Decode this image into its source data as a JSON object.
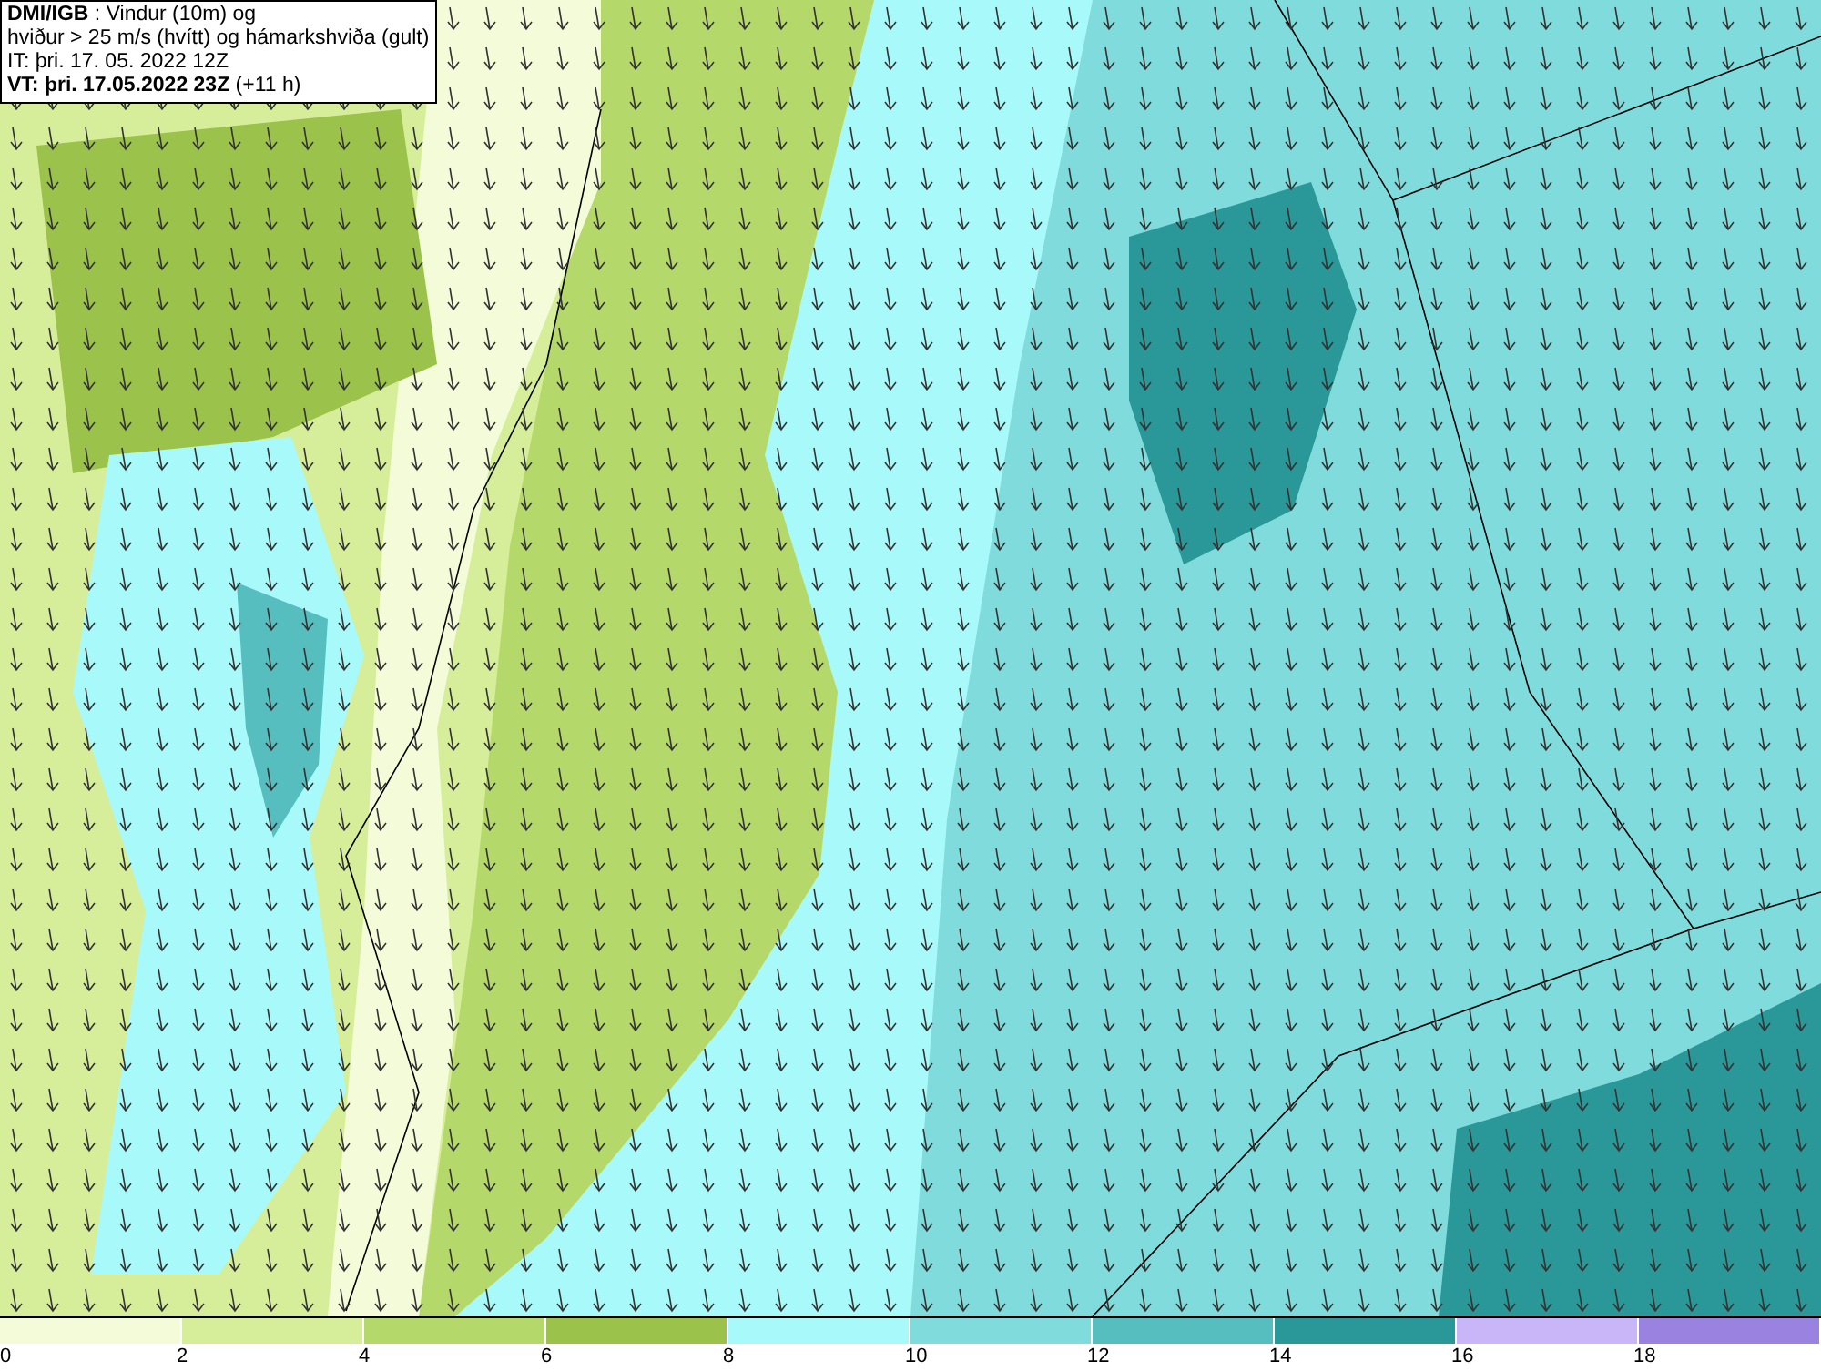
{
  "title_box": {
    "lines": [
      "**DMI/IGB** : Vindur (10m) og",
      "hviður > 25 m/s (hvítt) og hámarkshviða (gult)",
      "IT: þri. 17. 05. 2022 12Z",
      "**VT: þri. 17.05.2022 23Z** (+11 h)"
    ]
  },
  "legend": {
    "bins": [
      {
        "label": "0",
        "color": "#f4fbd8"
      },
      {
        "label": "2",
        "color": "#d6ee9a"
      },
      {
        "label": "4",
        "color": "#b5d86b"
      },
      {
        "label": "6",
        "color": "#9bc24a"
      },
      {
        "label": "8",
        "color": "#a8fafa"
      },
      {
        "label": "10",
        "color": "#80dcdc"
      },
      {
        "label": "12",
        "color": "#56bebe"
      },
      {
        "label": "14",
        "color": "#2a9898"
      },
      {
        "label": "16",
        "color": "#c8b6f8"
      },
      {
        "label": "18",
        "color": "#9a82e0"
      }
    ]
  }
}
